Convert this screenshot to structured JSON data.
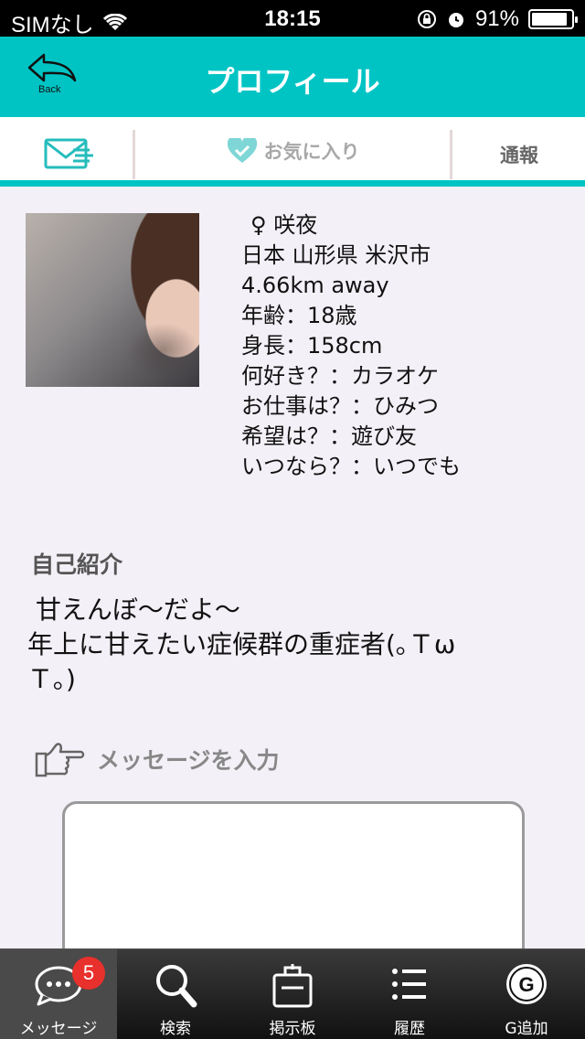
{
  "status_bar": {
    "carrier": "SIMなし",
    "time": "18:15",
    "battery_percent": "91%",
    "battery_level": 0.91
  },
  "header": {
    "title": "プロフィール",
    "back_label": "Back"
  },
  "tabs": {
    "favorite_label": "お気に入り",
    "report_label": "通報"
  },
  "profile": {
    "gender_symbol": "♀",
    "name": "咲夜",
    "location": "日本 山形県 米沢市",
    "distance": "4.66km away",
    "age": "年齢：18歳",
    "height": "身長：158cm",
    "likes": "何好き？：カラオケ",
    "job": "お仕事は？：ひみつ",
    "wish": "希望は？：遊び友",
    "when": "いつなら？：いつでも"
  },
  "intro": {
    "heading": "自己紹介",
    "text": " 甘えんぼ〜だよ〜\n年上に甘えたい症候群の重症者(｡Ｔω\nＴ｡)"
  },
  "message": {
    "prompt": "メッセージを入力",
    "value": ""
  },
  "bottom_nav": {
    "items": [
      {
        "label": "メッセージ",
        "icon": "speech-bubble-icon",
        "badge": "5"
      },
      {
        "label": "検索",
        "icon": "search-icon"
      },
      {
        "label": "掲示板",
        "icon": "clipboard-icon"
      },
      {
        "label": "履歴",
        "icon": "list-icon"
      },
      {
        "label": "G追加",
        "icon": "g-coin-icon"
      }
    ]
  },
  "colors": {
    "accent": "#00c4c4",
    "badge": "#e8302c"
  }
}
